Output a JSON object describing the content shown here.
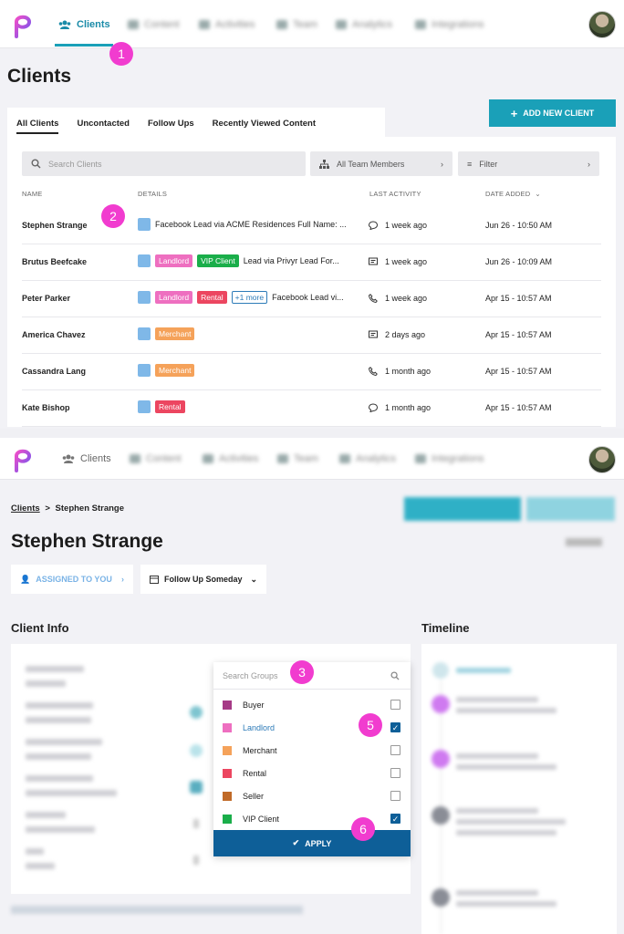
{
  "panel1": {
    "nav": {
      "active_tab": "Clients",
      "blurred_tabs": [
        "Content",
        "Activities",
        "Team",
        "Analytics",
        "Integrations"
      ]
    },
    "page_title": "Clients",
    "badge_1": "1",
    "badge_2": "2",
    "tabs": [
      "All Clients",
      "Uncontacted",
      "Follow Ups",
      "Recently Viewed Content"
    ],
    "add_button": "ADD NEW CLIENT",
    "search_placeholder": "Search Clients",
    "team_select": "All Team Members",
    "filter_select": "Filter",
    "columns": [
      "NAME",
      "DETAILS",
      "LAST ACTIVITY",
      "DATE ADDED"
    ],
    "rows": [
      {
        "name": "Stephen Strange",
        "tags": [],
        "more": "",
        "detail": "Facebook Lead via ACME Residences Full Name: ...",
        "activity_icon": "chat-icon",
        "activity": "1 week ago",
        "date": "Jun 26 - 10:50 AM"
      },
      {
        "name": "Brutus Beefcake",
        "tags": [
          {
            "label": "Landlord",
            "color": "#ee6fc0"
          },
          {
            "label": "VIP Client",
            "color": "#1aae4a"
          }
        ],
        "more": "",
        "detail": "Lead via Privyr Lead For...",
        "activity_icon": "message-icon",
        "activity": "1 week ago",
        "date": "Jun 26 - 10:09 AM"
      },
      {
        "name": "Peter Parker",
        "tags": [
          {
            "label": "Landlord",
            "color": "#ee6fc0"
          },
          {
            "label": "Rental",
            "color": "#ec4660"
          }
        ],
        "more": "+1 more",
        "detail": "Facebook Lead vi...",
        "activity_icon": "phone-icon",
        "activity": "1 week ago",
        "date": "Apr 15 - 10:57 AM"
      },
      {
        "name": "America Chavez",
        "tags": [
          {
            "label": "Merchant",
            "color": "#f5a25a"
          }
        ],
        "more": "",
        "detail": "",
        "activity_icon": "message-icon",
        "activity": "2 days ago",
        "date": "Apr 15 - 10:57 AM"
      },
      {
        "name": "Cassandra Lang",
        "tags": [
          {
            "label": "Merchant",
            "color": "#f5a25a"
          }
        ],
        "more": "",
        "detail": "",
        "activity_icon": "phone-icon",
        "activity": "1 month ago",
        "date": "Apr 15 - 10:57 AM"
      },
      {
        "name": "Kate Bishop",
        "tags": [
          {
            "label": "Rental",
            "color": "#ec4660"
          }
        ],
        "more": "",
        "detail": "",
        "activity_icon": "chat-icon",
        "activity": "1 month ago",
        "date": "Apr 15 - 10:57 AM"
      }
    ]
  },
  "panel2": {
    "nav_active": "Clients",
    "breadcrumb_link": "Clients",
    "breadcrumb_sep": ">",
    "breadcrumb_current": "Stephen Strange",
    "client_name": "Stephen Strange",
    "assigned": "ASSIGNED TO YOU",
    "follow_up": "Follow Up Someday",
    "client_info_title": "Client Info",
    "timeline_title": "Timeline",
    "badge_3": "3",
    "badge_5": "5",
    "badge_6": "6",
    "groups_placeholder": "Search Groups",
    "groups": [
      {
        "label": "Buyer",
        "color": "#a63a86",
        "checked": false
      },
      {
        "label": "Landlord",
        "color": "#ee6fc0",
        "checked": true
      },
      {
        "label": "Merchant",
        "color": "#f5a25a",
        "checked": false
      },
      {
        "label": "Rental",
        "color": "#ec4660",
        "checked": false
      },
      {
        "label": "Seller",
        "color": "#c06a28",
        "checked": false
      },
      {
        "label": "VIP Client",
        "color": "#1aae4a",
        "checked": true
      }
    ],
    "apply": "APPLY"
  }
}
